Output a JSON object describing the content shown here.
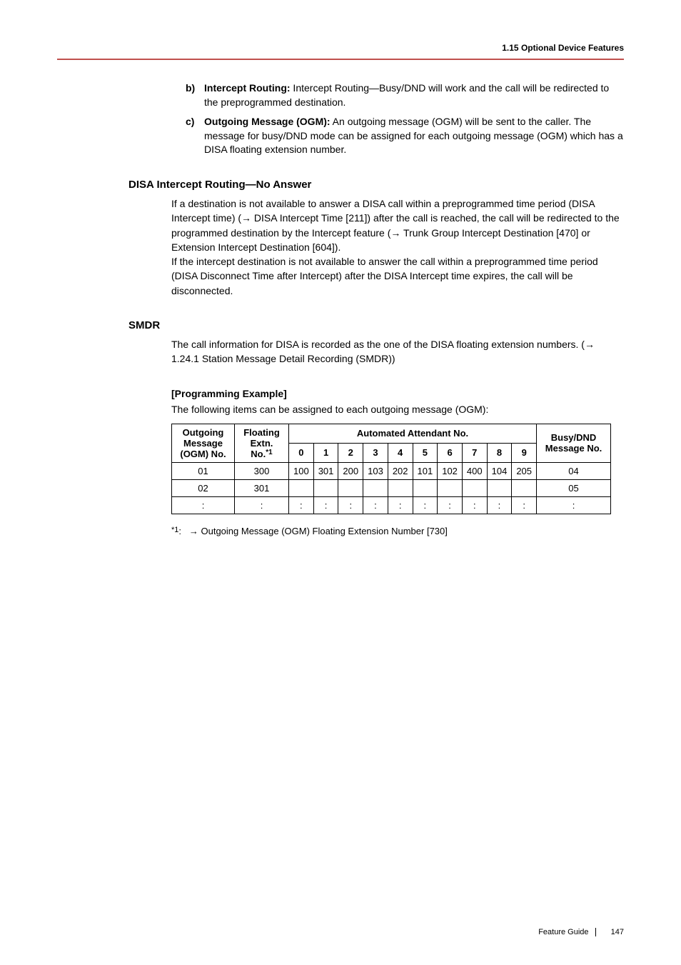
{
  "header": {
    "section": "1.15 Optional Device Features"
  },
  "list_b": {
    "marker": "b)",
    "label": "Intercept Routing:",
    "text": " Intercept Routing—Busy/DND will work and the call will be redirected to the preprogrammed destination."
  },
  "list_c": {
    "marker": "c)",
    "label": "Outgoing Message (OGM):",
    "text": " An outgoing message (OGM) will be sent to the caller. The message for busy/DND mode can be assigned for each outgoing message (OGM) which has a DISA floating extension number."
  },
  "sections": {
    "intercept": {
      "title": "DISA Intercept Routing—No Answer",
      "body_1": "If a destination is not available to answer a DISA call within a preprogrammed time period (DISA Intercept time) (",
      "body_2": " DISA Intercept Time [211]) after the call is reached, the call will be redirected to the programmed destination by the Intercept feature (",
      "body_3": " Trunk Group Intercept Destination [470] or Extension Intercept Destination [604]).",
      "body_4": "If the intercept destination is not available to answer the call within a preprogrammed time period (DISA Disconnect Time after Intercept) after the DISA Intercept time expires, the call will be disconnected."
    },
    "smdr": {
      "title": "SMDR",
      "body_1": "The call information for DISA is recorded as the one of the DISA floating extension numbers. (",
      "body_2": " 1.24.1 Station Message Detail Recording (SMDR))"
    },
    "prog": {
      "title": "[Programming Example]",
      "sub": "The following items can be assigned to each outgoing message (OGM):"
    }
  },
  "table": {
    "headers": {
      "c1": "Outgoing Message (OGM) No.",
      "c2a": "Floating Extn. No.",
      "c2b": "*1",
      "aa": "Automated Attendant No.",
      "aa_nums": [
        "0",
        "1",
        "2",
        "3",
        "4",
        "5",
        "6",
        "7",
        "8",
        "9"
      ],
      "bd": "Busy/DND Message No."
    },
    "rows": [
      {
        "ogm": "01",
        "ext": "300",
        "aa": [
          "100",
          "301",
          "200",
          "103",
          "202",
          "101",
          "102",
          "400",
          "104",
          "205"
        ],
        "bd": "04"
      },
      {
        "ogm": "02",
        "ext": "301",
        "aa": [
          "",
          "",
          "",
          "",
          "",
          "",
          "",
          "",
          "",
          ""
        ],
        "bd": "05"
      },
      {
        "ogm": ":",
        "ext": ":",
        "aa": [
          ":",
          ":",
          ":",
          ":",
          ":",
          ":",
          ":",
          ":",
          ":",
          ":"
        ],
        "bd": ":"
      }
    ]
  },
  "footnote": {
    "star": "*1",
    "colon": ":",
    "text": " Outgoing Message (OGM) Floating Extension Number [730]"
  },
  "footer": {
    "label": "Feature Guide",
    "page": "147"
  }
}
